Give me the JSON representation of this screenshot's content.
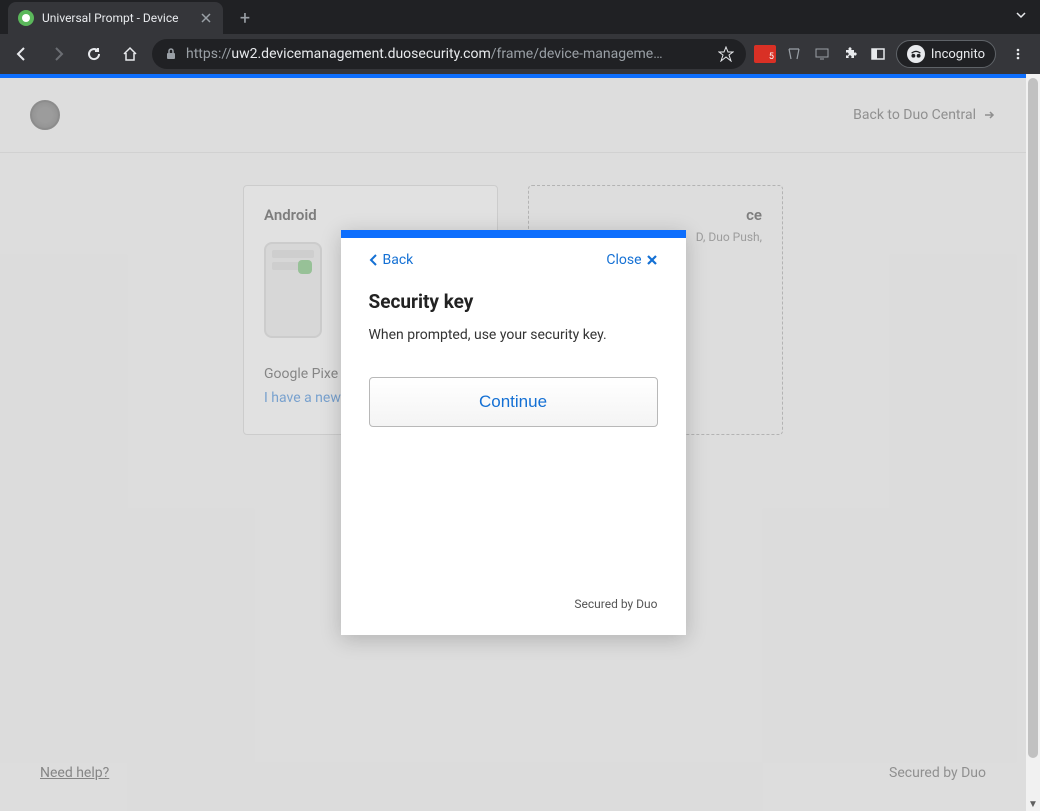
{
  "browser": {
    "tab_title": "Universal Prompt - Device",
    "url_display_prefix": "https://",
    "url_display_host": "uw2.devicemanagement.duosecurity.com",
    "url_display_path": "/frame/device-manageme…",
    "ext_badge": "5",
    "incognito_label": "Incognito"
  },
  "header": {
    "back_link": "Back to Duo Central"
  },
  "cards": {
    "android": {
      "title": "Android",
      "device_name": "Google Pixe",
      "new_phone_link": "I have a new"
    },
    "add": {
      "title_suffix": "ce",
      "methods": "D, Duo Push,"
    }
  },
  "footer": {
    "need_help": "Need help?",
    "secured": "Secured by Duo"
  },
  "modal": {
    "back": "Back",
    "close": "Close",
    "title": "Security key",
    "text": "When prompted, use your security key.",
    "continue": "Continue",
    "secured": "Secured by Duo"
  }
}
